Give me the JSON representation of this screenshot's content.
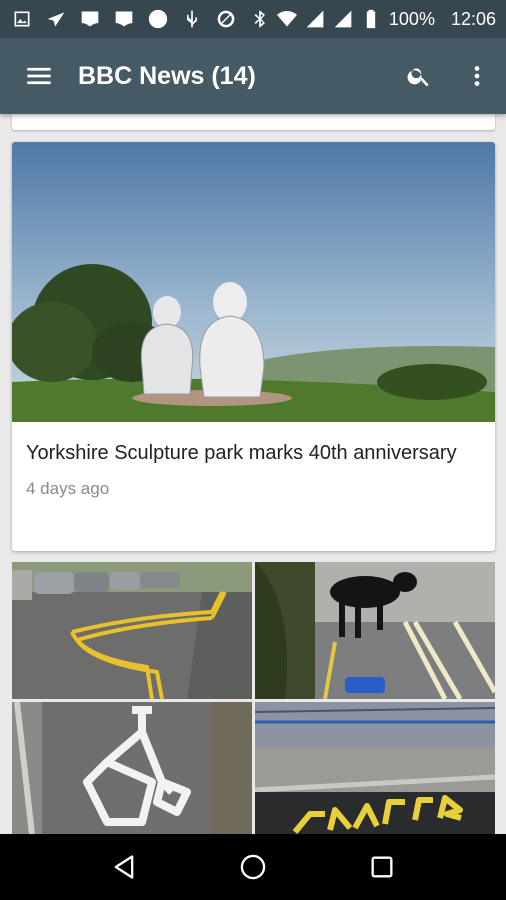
{
  "status_bar": {
    "battery_percent": "100%",
    "time": "12:06",
    "icons": [
      "image-icon",
      "send-icon",
      "notification-icon",
      "notification-icon",
      "circle-icon",
      "usb-icon",
      "block-icon",
      "bluetooth-icon",
      "wifi-icon",
      "signal-icon",
      "signal-icon",
      "battery-icon"
    ]
  },
  "app_bar": {
    "title": "BBC News (14)",
    "icons": [
      "menu-icon",
      "search-icon",
      "more-vert-icon"
    ]
  },
  "feed": {
    "featured": {
      "headline": "Yorkshire Sculpture park marks 40th anniversary",
      "age": "4 days ago",
      "image": "sculpture-park-photo"
    },
    "grid_images": [
      "yellow-lines-road-photo",
      "dog-yellow-lines-photo",
      "bicycle-marking-photo",
      "clear-road-marking-photo"
    ]
  },
  "nav_bar": {
    "icons": [
      "back-icon",
      "home-icon",
      "recents-icon"
    ]
  },
  "colors": {
    "status_bar": "#37474f",
    "app_bar": "#455a64",
    "background": "#e9e9e9",
    "card": "#ffffff"
  }
}
